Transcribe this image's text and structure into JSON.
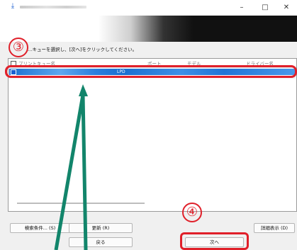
{
  "window": {
    "app_icon": "download-arrow-icon",
    "minimize_glyph": "–",
    "maximize_glyph": "□",
    "close_glyph": "✕"
  },
  "annotations": {
    "step3": "③",
    "step4": "④",
    "highlight_color": "#e0202a",
    "arrow_color": "#12856b"
  },
  "instruction": "…キューを選択し、[次へ]をクリックしてください。",
  "table": {
    "headers": [
      "プリントキュー名",
      "ポート",
      "モデル",
      "ドライバー名"
    ],
    "rows": [
      {
        "checked": true,
        "port": "LPD",
        "selected": true
      }
    ]
  },
  "buttons": {
    "search": "検索条件... (S)",
    "refresh": "更新 (R)",
    "detail": "詳細表示 (D)",
    "back": "戻る",
    "next": "次へ"
  },
  "colors": {
    "selection": "#1a6fd0",
    "banner_dark": "#111111"
  }
}
